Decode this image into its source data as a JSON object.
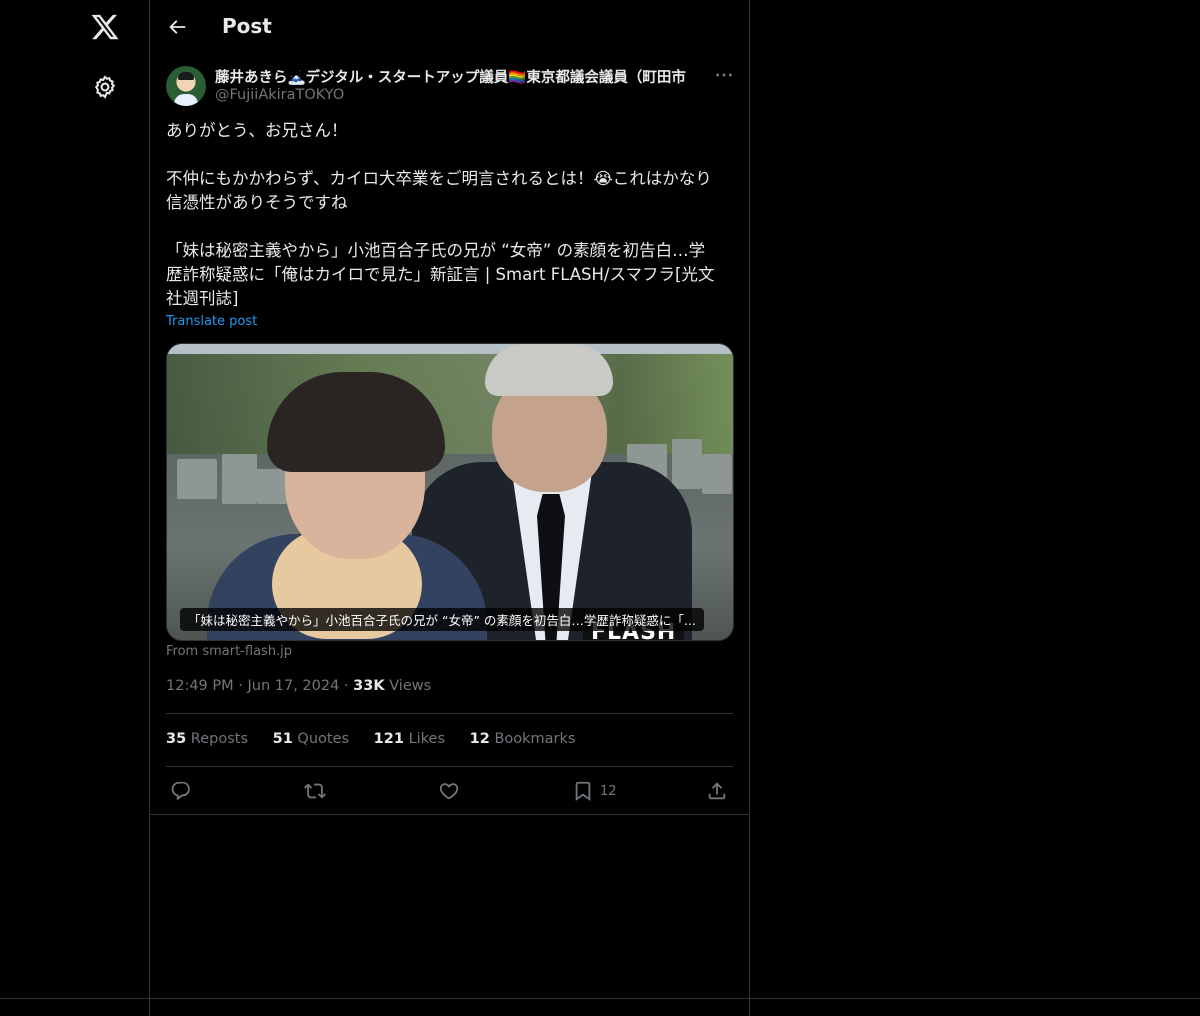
{
  "nav": {
    "logo": "x-logo-icon",
    "settings": "gear-icon"
  },
  "header": {
    "title": "Post",
    "back_icon": "back-arrow-icon"
  },
  "author": {
    "display_name": "藤井あきら🗻デジタル・スタートアップ議員🏳️‍🌈東京都議会議員（町田市",
    "handle": "@FujiiAkiraTOKYO"
  },
  "tweet": {
    "paragraphs": [
      "ありがとう、お兄さん！",
      "不仲にもかかわらず、カイロ大卒業をご明言されるとは！😭これはかなり\n信憑性がありそうですね",
      "「妹は秘密主義やから」小池百合子氏の兄が “女帝” の素顔を初告白…学\n歴詐称疑惑に「俺はカイロで見た」新証言 | Smart FLASH/スマフラ[光文\n社週刊誌]"
    ],
    "translate": "Translate post"
  },
  "card": {
    "caption": "「妹は秘密主義やから」小池百合子氏の兄が “女帝” の素顔を初告白…学歴詐称疑惑に「...",
    "source": "From smart-flash.jp",
    "watermark": "FLASH"
  },
  "meta": {
    "time": "12:49 PM",
    "date": "Jun 17, 2024",
    "views_count": "33K",
    "views_label": "Views"
  },
  "stats": {
    "reposts": {
      "count": "35",
      "label": "Reposts"
    },
    "quotes": {
      "count": "51",
      "label": "Quotes"
    },
    "likes": {
      "count": "121",
      "label": "Likes"
    },
    "bookmarks": {
      "count": "12",
      "label": "Bookmarks"
    }
  },
  "actions": {
    "reply_icon": "reply-icon",
    "repost_icon": "repost-icon",
    "like_icon": "heart-icon",
    "bookmark_icon": "bookmark-icon",
    "bookmark_count": "12",
    "share_icon": "share-icon"
  },
  "colors": {
    "background": "#000000",
    "text": "#e7e9ea",
    "muted": "#71767b",
    "link": "#1d9bf0",
    "border": "#2f3336"
  }
}
